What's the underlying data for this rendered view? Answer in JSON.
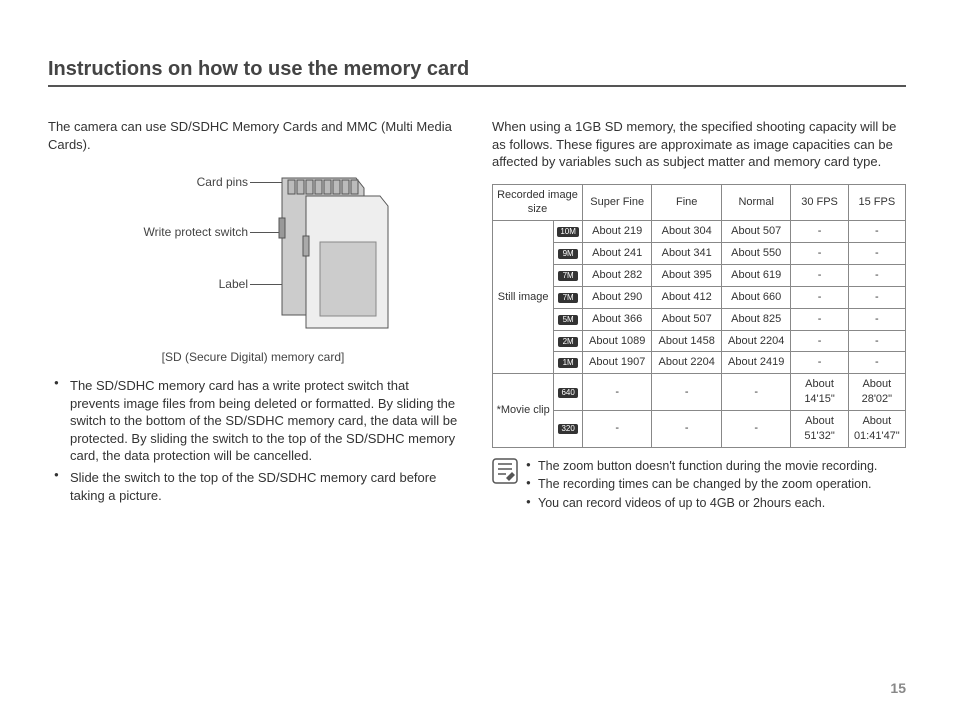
{
  "title": "Instructions on how to use the memory card",
  "intro_left": "The camera can use SD/SDHC Memory Cards and MMC (Multi Media Cards).",
  "diagram": {
    "label_pins": "Card pins",
    "label_switch": "Write protect switch",
    "label_label": "Label",
    "caption": "[SD (Secure Digital) memory card]"
  },
  "bullets_left": [
    "The SD/SDHC memory card has a write protect switch that prevents image files from being deleted or formatted. By sliding the switch to the bottom of the SD/SDHC memory card, the data will be protected. By sliding the switch to the top of the SD/SDHC memory card, the data protection will be cancelled.",
    "Slide the switch to the top of the SD/SDHC memory card before taking a picture."
  ],
  "intro_right": "When using a 1GB SD memory, the specified shooting capacity will be as follows. These figures are approximate as image capacities can be affected by variables such as subject matter and memory card type.",
  "table": {
    "headers": {
      "recorded": "Recorded image size",
      "super_fine": "Super Fine",
      "fine": "Fine",
      "normal": "Normal",
      "fps30": "30 FPS",
      "fps15": "15 FPS"
    },
    "groups": {
      "still": "Still image",
      "movie": "*Movie clip"
    },
    "still_rows": [
      {
        "icon": "10M",
        "sf": "About 219",
        "f": "About 304",
        "n": "About 507",
        "fps30": "-",
        "fps15": "-"
      },
      {
        "icon": "9M",
        "sf": "About 241",
        "f": "About 341",
        "n": "About 550",
        "fps30": "-",
        "fps15": "-"
      },
      {
        "icon": "7M",
        "sf": "About 282",
        "f": "About 395",
        "n": "About 619",
        "fps30": "-",
        "fps15": "-"
      },
      {
        "icon": "7M",
        "sf": "About 290",
        "f": "About 412",
        "n": "About 660",
        "fps30": "-",
        "fps15": "-"
      },
      {
        "icon": "5M",
        "sf": "About 366",
        "f": "About 507",
        "n": "About 825",
        "fps30": "-",
        "fps15": "-"
      },
      {
        "icon": "2M",
        "sf": "About 1089",
        "f": "About 1458",
        "n": "About 2204",
        "fps30": "-",
        "fps15": "-"
      },
      {
        "icon": "1M",
        "sf": "About 1907",
        "f": "About 2204",
        "n": "About 2419",
        "fps30": "-",
        "fps15": "-"
      }
    ],
    "movie_rows": [
      {
        "icon": "640",
        "sf": "-",
        "f": "-",
        "n": "-",
        "fps30": "About 14'15\"",
        "fps15": "About 28'02\""
      },
      {
        "icon": "320",
        "sf": "-",
        "f": "-",
        "n": "-",
        "fps30": "About 51'32\"",
        "fps15": "About 01:41'47\""
      }
    ]
  },
  "notes": [
    "The zoom button doesn't function during the movie recording.",
    "The recording times can be changed by the zoom operation.",
    "You can record videos of up to 4GB or 2hours each."
  ],
  "page_number": "15"
}
